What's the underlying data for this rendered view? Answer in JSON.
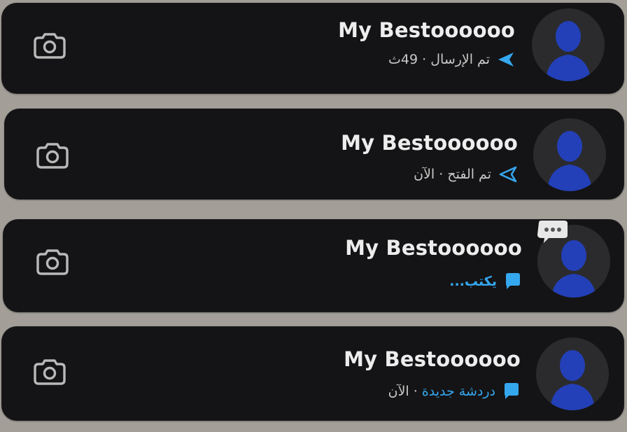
{
  "chats": [
    {
      "name": "My Bestoooooo",
      "status_state": "تم الإرسال",
      "status_separator": " · ",
      "status_time": "49ث",
      "status_icon": "sent-arrow-filled-icon"
    },
    {
      "name": "My Bestoooooo",
      "status_state": "تم الفتح",
      "status_separator": " · ",
      "status_time": "الآن",
      "status_icon": "opened-arrow-outline-icon"
    },
    {
      "name": "My Bestoooooo",
      "status_state": "يكتب...",
      "status_icon": "chat-bubble-icon",
      "typing_indicator_icon": "typing-dots-icon"
    },
    {
      "name": "My Bestoooooo",
      "status_state": "دردشة جديدة",
      "status_separator": " · ",
      "status_time": "الآن",
      "status_icon": "chat-bubble-icon"
    }
  ],
  "colors": {
    "background": "#a39f98",
    "card": "#141416",
    "accent_blue": "#35a7ee",
    "avatar_blue": "#2340b8"
  }
}
